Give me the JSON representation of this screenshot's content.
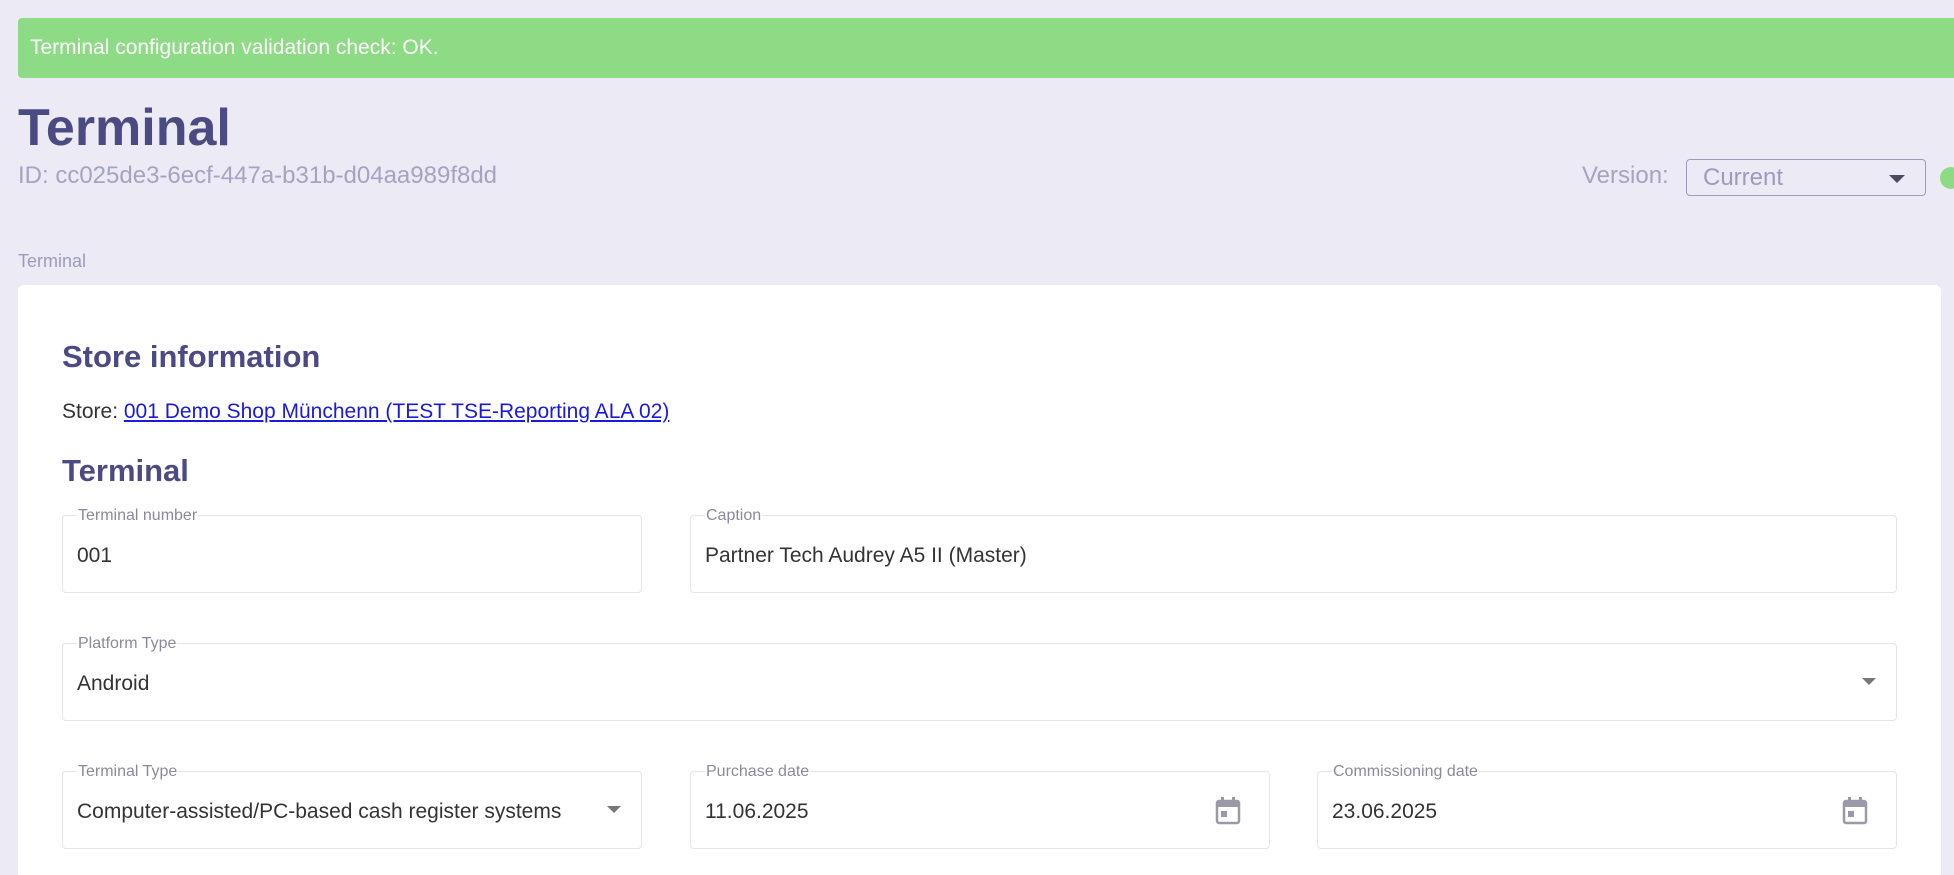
{
  "alert": {
    "message": "Terminal configuration validation check: OK.",
    "color": "#8edb86"
  },
  "header": {
    "title": "Terminal",
    "id_text": "ID: cc025de3-6ecf-447a-b31b-d04aa989f8dd",
    "version_label": "Version:",
    "version_value": "Current"
  },
  "section_label": "Terminal",
  "store_info": {
    "heading": "Store information",
    "store_prefix": "Store:",
    "store_link": "001 Demo Shop Münchenn (TEST TSE-Reporting ALA 02)"
  },
  "terminal": {
    "heading": "Terminal",
    "terminal_number": {
      "label": "Terminal number",
      "value": "001"
    },
    "caption": {
      "label": "Caption",
      "value": "Partner Tech Audrey A5 II (Master)"
    },
    "platform_type": {
      "label": "Platform Type",
      "value": "Android"
    },
    "terminal_type": {
      "label": "Terminal Type",
      "value": "Computer-assisted/PC-based cash register systems"
    },
    "purchase_date": {
      "label": "Purchase date",
      "value": "11.06.2025"
    },
    "commissioning_date": {
      "label": "Commissioning date",
      "value": "23.06.2025"
    }
  },
  "colors": {
    "heading": "#4b4a82",
    "muted": "#a4a3c2",
    "background": "#ecebf5",
    "link": "#1a1adb",
    "status_ok": "#8edb86"
  },
  "icons": {
    "date_picker": "calendar-icon",
    "dropdown": "chevron-down-icon"
  }
}
